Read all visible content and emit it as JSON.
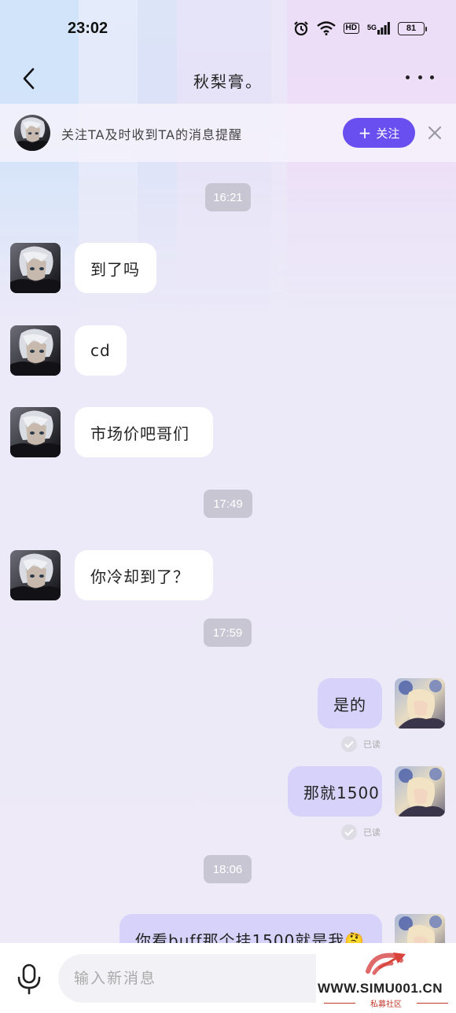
{
  "status_bar": {
    "time": "23:02",
    "network": "5G",
    "hd": "HD",
    "battery": "81"
  },
  "nav": {
    "title": "秋梨膏。"
  },
  "follow_bar": {
    "text": "关注TA及时收到TA的消息提醒",
    "button_label": "关注",
    "button_icon": "+"
  },
  "messages": [
    {
      "kind": "timestamp",
      "text": "16:21"
    },
    {
      "kind": "message",
      "side": "in",
      "text": "到了吗"
    },
    {
      "kind": "message",
      "side": "in",
      "text": "cd"
    },
    {
      "kind": "message",
      "side": "in",
      "text": "市场价吧哥们"
    },
    {
      "kind": "timestamp",
      "text": "17:49"
    },
    {
      "kind": "message",
      "side": "in",
      "text": "你冷却到了？"
    },
    {
      "kind": "timestamp",
      "text": "17:59"
    },
    {
      "kind": "message",
      "side": "out",
      "text": "是的",
      "status": "已读"
    },
    {
      "kind": "message",
      "side": "out",
      "text": "那就1500",
      "status": "已读"
    },
    {
      "kind": "timestamp",
      "text": "18:06"
    },
    {
      "kind": "message",
      "side": "out",
      "text": "你看buff那个挂1500就是我🤔"
    }
  ],
  "input": {
    "placeholder": "输入新消息"
  },
  "watermark": {
    "text": "WWW.SIMU001.CN",
    "subtitle": "私募社区"
  },
  "colors": {
    "accent": "#6a4ff0",
    "outgoing_bubble": "#d7d2fa",
    "incoming_bubble": "#ffffff",
    "timestamp_bg": "#c9c6d3"
  },
  "icons": {
    "back": "chevron-left-icon",
    "more": "more-dots-icon",
    "close": "close-icon",
    "mic": "microphone-icon",
    "check": "check-icon"
  }
}
